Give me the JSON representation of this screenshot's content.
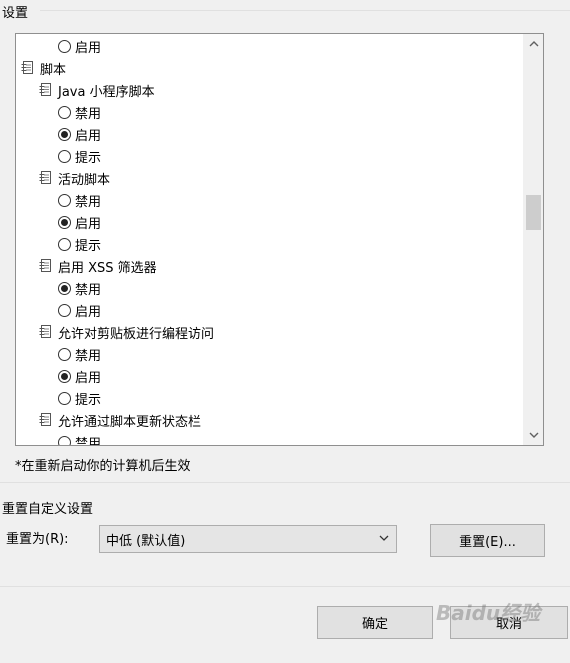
{
  "settings": {
    "title": "设置",
    "tree": [
      {
        "type": "radio",
        "level": 2,
        "label": "启用",
        "checked": false
      },
      {
        "type": "group",
        "level": 0,
        "label": "脚本"
      },
      {
        "type": "group",
        "level": 1,
        "label": "Java 小程序脚本"
      },
      {
        "type": "radio",
        "level": 2,
        "label": "禁用",
        "checked": false
      },
      {
        "type": "radio",
        "level": 2,
        "label": "启用",
        "checked": true
      },
      {
        "type": "radio",
        "level": 2,
        "label": "提示",
        "checked": false
      },
      {
        "type": "group",
        "level": 1,
        "label": "活动脚本"
      },
      {
        "type": "radio",
        "level": 2,
        "label": "禁用",
        "checked": false
      },
      {
        "type": "radio",
        "level": 2,
        "label": "启用",
        "checked": true
      },
      {
        "type": "radio",
        "level": 2,
        "label": "提示",
        "checked": false
      },
      {
        "type": "group",
        "level": 1,
        "label": "启用 XSS 筛选器"
      },
      {
        "type": "radio",
        "level": 2,
        "label": "禁用",
        "checked": true
      },
      {
        "type": "radio",
        "level": 2,
        "label": "启用",
        "checked": false
      },
      {
        "type": "group",
        "level": 1,
        "label": "允许对剪贴板进行编程访问"
      },
      {
        "type": "radio",
        "level": 2,
        "label": "禁用",
        "checked": false
      },
      {
        "type": "radio",
        "level": 2,
        "label": "启用",
        "checked": true
      },
      {
        "type": "radio",
        "level": 2,
        "label": "提示",
        "checked": false
      },
      {
        "type": "group",
        "level": 1,
        "label": "允许通过脚本更新状态栏"
      },
      {
        "type": "radio",
        "level": 2,
        "label": "禁用",
        "checked": false
      }
    ],
    "note": "*在重新启动你的计算机后生效"
  },
  "reset_section": {
    "title": "重置自定义设置",
    "reset_to_label": "重置为(R):",
    "selected_value": "中低 (默认值)",
    "reset_button": "重置(E)..."
  },
  "footer": {
    "ok_button": "确定",
    "cancel_button": "取消"
  },
  "watermark": "Baidu经验",
  "icons": {
    "group": "script-document-icon",
    "scroll_up": "chevron-up-icon",
    "scroll_down": "chevron-down-icon",
    "dropdown": "chevron-down-icon"
  }
}
